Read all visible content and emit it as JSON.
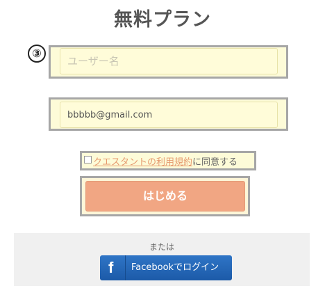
{
  "page": {
    "title": "無料プラン",
    "step_badge": "③"
  },
  "form": {
    "username_placeholder": "ユーザー名",
    "email_value": "bbbbb@gmail.com",
    "terms_link": "クエスタントの利用規約",
    "terms_suffix": "に同意する",
    "submit_label": "はじめる"
  },
  "social": {
    "or_text": "または",
    "facebook_icon_text": "f",
    "facebook_label": "Facebookでログイン",
    "icon": "facebook-icon"
  },
  "colors": {
    "highlight_border": "#a6a6a6",
    "input_background": "#fffcd9",
    "accent": "#f1a683",
    "facebook_blue": "#1f5fb0"
  }
}
